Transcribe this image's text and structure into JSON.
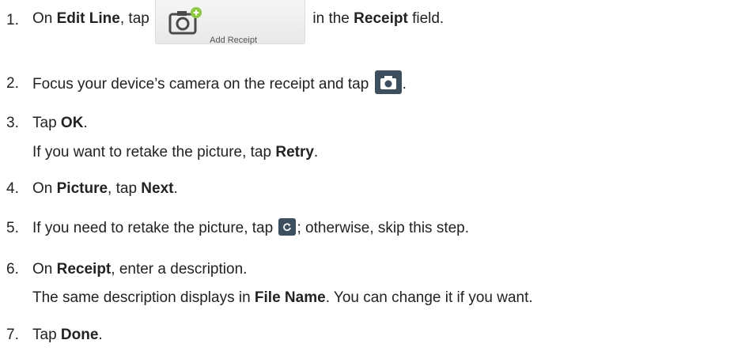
{
  "steps": [
    {
      "num": "1.",
      "parts": [
        "On ",
        "Edit Line",
        ", tap ",
        " in the ",
        "Receipt",
        " field."
      ],
      "button_label": "Add Receipt"
    },
    {
      "num": "2.",
      "parts": [
        "Focus your device’s camera on the receipt and tap ",
        "."
      ]
    },
    {
      "num": "3.",
      "parts": [
        "Tap ",
        "OK",
        "."
      ],
      "sub": [
        "If you want to retake the picture, tap ",
        "Retry",
        "."
      ]
    },
    {
      "num": "4.",
      "parts": [
        "On ",
        "Picture",
        ", tap ",
        "Next",
        "."
      ]
    },
    {
      "num": "5.",
      "parts": [
        "If you need to retake the picture, tap ",
        "; otherwise, skip this step."
      ]
    },
    {
      "num": "6.",
      "parts": [
        "On ",
        "Receipt",
        ", enter a description."
      ],
      "sub": [
        "The same description displays in ",
        "File Name",
        ". You can change it if you want."
      ]
    },
    {
      "num": "7.",
      "parts": [
        "Tap ",
        "Done",
        "."
      ]
    }
  ],
  "icons": {
    "add_receipt": "camera-plus-icon",
    "shutter": "camera-icon",
    "retake": "refresh-icon"
  },
  "colors": {
    "text": "#222222",
    "icon_button_bg": "#3d4f5e",
    "add_green": "#8dc63f"
  }
}
